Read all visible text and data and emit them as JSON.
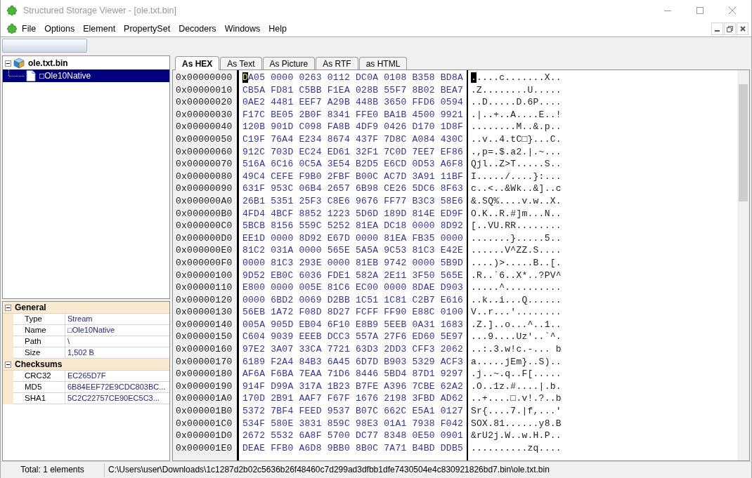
{
  "window": {
    "title": "Structured Storage Viewer - [ole.txt.bin]"
  },
  "menu": [
    "File",
    "Options",
    "Element",
    "PropertySet",
    "Decoders",
    "Windows",
    "Help"
  ],
  "tree": [
    {
      "label": "ole.txt.bin",
      "kind": "storage",
      "expanded": true,
      "selected": false,
      "children": [
        {
          "label": "□Ole10Native",
          "kind": "stream",
          "selected": true
        }
      ]
    }
  ],
  "properties": [
    {
      "category": "General",
      "expanded": true,
      "rows": [
        {
          "name": "Type",
          "value": "Stream"
        },
        {
          "name": "Name",
          "value": "□Ole10Native"
        },
        {
          "name": "Path",
          "value": "\\"
        },
        {
          "name": "Size",
          "value": "1,502 B"
        }
      ]
    },
    {
      "category": "Checksums",
      "expanded": true,
      "rows": [
        {
          "name": "CRC32",
          "value": "EC265D7F"
        },
        {
          "name": "MD5",
          "value": "6B84EEF72E9CDC803BC..."
        },
        {
          "name": "SHA1",
          "value": "5C2C22757CE90EC5C3..."
        }
      ]
    }
  ],
  "tabs": [
    {
      "label": "As HEX",
      "selected": true
    },
    {
      "label": "As Text",
      "selected": false
    },
    {
      "label": "As Picture",
      "selected": false
    },
    {
      "label": "As RTF",
      "selected": false
    },
    {
      "label": "as HTML",
      "selected": false
    }
  ],
  "hex_view": {
    "rows": [
      {
        "offset": "0x00000000",
        "hex": "DA05 0000 0263 0112 DC0A 0108 B358 BD8A",
        "ascii": ".....c.......X..",
        "cursor": true
      },
      {
        "offset": "0x00000010",
        "hex": "CB5A FD81 C5BB F1EA 028B 55F7 8B02 BEA7",
        "ascii": ".Z........U.....",
        "cursor": false
      },
      {
        "offset": "0x00000020",
        "hex": "0AE2 4481 EEF7 A29B 448B 3650 FFD6 0594",
        "ascii": "..D.....D.6P....",
        "cursor": false
      },
      {
        "offset": "0x00000030",
        "hex": "F17C BE05 2B0F 8341 FFE0 BA1B 4500 9921",
        "ascii": ".|..+..A....E..!",
        "cursor": false
      },
      {
        "offset": "0x00000040",
        "hex": "120B 901D C098 FA8B 4DF9 0426 D170 1D8F",
        "ascii": "........M..&.p..",
        "cursor": false
      },
      {
        "offset": "0x00000050",
        "hex": "C19F 76A4 E234 8674 437F 7D8C A084 430C",
        "ascii": "..v..4.tC□}...C.",
        "cursor": false
      },
      {
        "offset": "0x00000060",
        "hex": "912C 703D EC24 ED61 32F1 7C0D 7EE7 EF86",
        "ascii": ".,p=.$.a2.|.~...",
        "cursor": false
      },
      {
        "offset": "0x00000070",
        "hex": "516A 6C16 0C5A 3E54 B2D5 E6CD 0D53 A6F8",
        "ascii": "Qjl..Z>T.....S..",
        "cursor": false
      },
      {
        "offset": "0x00000080",
        "hex": "49C4 CEFE F9B0 2FBF B00C AC7D 3A91 11BF",
        "ascii": "I...../....}:...",
        "cursor": false
      },
      {
        "offset": "0x00000090",
        "hex": "631F 953C 06B4 2657 6B98 CE26 5DC6 8F63",
        "ascii": "c..<..&Wk..&]..c",
        "cursor": false
      },
      {
        "offset": "0x000000A0",
        "hex": "26B1 5351 25F3 C8E6 9676 FF77 B3C3 58E6",
        "ascii": "&.SQ%....v.w..X.",
        "cursor": false
      },
      {
        "offset": "0x000000B0",
        "hex": "4FD4 4BCF 8852 1223 5D6D 189D 814E ED9F",
        "ascii": "O.K..R.#]m...N..",
        "cursor": false
      },
      {
        "offset": "0x000000C0",
        "hex": "5BCB 8156 559C 5252 81EA DC18 0000 8D92",
        "ascii": "[..VU.RR........",
        "cursor": false
      },
      {
        "offset": "0x000000D0",
        "hex": "EE1D 0000 8D92 E67D 0000 81EA FB35 0000",
        "ascii": ".......}.....5..",
        "cursor": false
      },
      {
        "offset": "0x000000E0",
        "hex": "81C2 031A 0000 565E 5A5A 9C53 81C3 E42E",
        "ascii": "......V^ZZ.S....",
        "cursor": false
      },
      {
        "offset": "0x000000F0",
        "hex": "0000 81C3 293E 0000 81EB 9742 0000 5B9D",
        "ascii": "....)>.....B..[.",
        "cursor": false
      },
      {
        "offset": "0x00000100",
        "hex": "9D52 EB0C 6036 FDE1 582A 2E11 3F50 565E",
        "ascii": ".R..`6..X*..?PV^",
        "cursor": false
      },
      {
        "offset": "0x00000110",
        "hex": "E800 0000 005E 81C6 EC00 0000 8DAE D903",
        "ascii": ".....^..........",
        "cursor": false
      },
      {
        "offset": "0x00000120",
        "hex": "0000 6BD2 0069 D2BB 1C51 1C81 C2B7 E616",
        "ascii": "..k..i...Q......",
        "cursor": false
      },
      {
        "offset": "0x00000130",
        "hex": "56EB 1A72 F08D 8D27 FCFF FF90 E88C 0100",
        "ascii": "V..r...'........",
        "cursor": false
      },
      {
        "offset": "0x00000140",
        "hex": "005A 905D EB04 6F10 E8B9 5EEB 0A31 1683",
        "ascii": ".Z.]..o...^..1..",
        "cursor": false
      },
      {
        "offset": "0x00000150",
        "hex": "C604 9039 EEEB DCC3 557A 27F6 ED60 5E97",
        "ascii": "...9....Uz'..`^.",
        "cursor": false
      },
      {
        "offset": "0x00000160",
        "hex": "97E2 3A07 33CA 7721 63D3 2DD3 CFF3 2062",
        "ascii": "..:.3.w!c.-... b",
        "cursor": false
      },
      {
        "offset": "0x00000170",
        "hex": "6189 F2A4 84B3 6A45 6D7D B903 5329 ACF3",
        "ascii": "a.....jEm}..S)..",
        "cursor": false
      },
      {
        "offset": "0x00000180",
        "hex": "AF6A F6BA 7EAA 71D6 8446 5BD4 87D1 9297",
        "ascii": ".j..~.q..F[.....",
        "cursor": false
      },
      {
        "offset": "0x00000190",
        "hex": "914F D99A 317A 1B23 B7FE A396 7CBE 62A2",
        "ascii": ".O..1z.#....|.b.",
        "cursor": false
      },
      {
        "offset": "0x000001A0",
        "hex": "170D 2B91 AAF7 F67F 1676 2198 3FBD AD62",
        "ascii": "..+....□.v!.?..b",
        "cursor": false
      },
      {
        "offset": "0x000001B0",
        "hex": "5372 7BF4 FEED 9537 B07C 662C E5A1 0127",
        "ascii": "Sr{....7.|f,...'",
        "cursor": false
      },
      {
        "offset": "0x000001C0",
        "hex": "534F 580E 3831 859C 98E3 01A1 7938 F042",
        "ascii": "SOX.81......y8.B",
        "cursor": false
      },
      {
        "offset": "0x000001D0",
        "hex": "2672 5532 6A8F 5700 DC77 8348 0E50 0901",
        "ascii": "&rU2j.W..w.H.P..",
        "cursor": false
      },
      {
        "offset": "0x000001E0",
        "hex": "DEAE FFB0 A6D8 9BB0 8B0C 7A71 B4BD DDB5",
        "ascii": "..........zq....",
        "cursor": false
      }
    ]
  },
  "status_bar": {
    "summary": "Total: 1 elements",
    "path": "C:\\Users\\user\\Downloads\\1c1287d2b02c5636b26f48460c7d299ad3dfbb1dfe7430504e4c830921826bd7.bin\\ole.txt.bin"
  }
}
